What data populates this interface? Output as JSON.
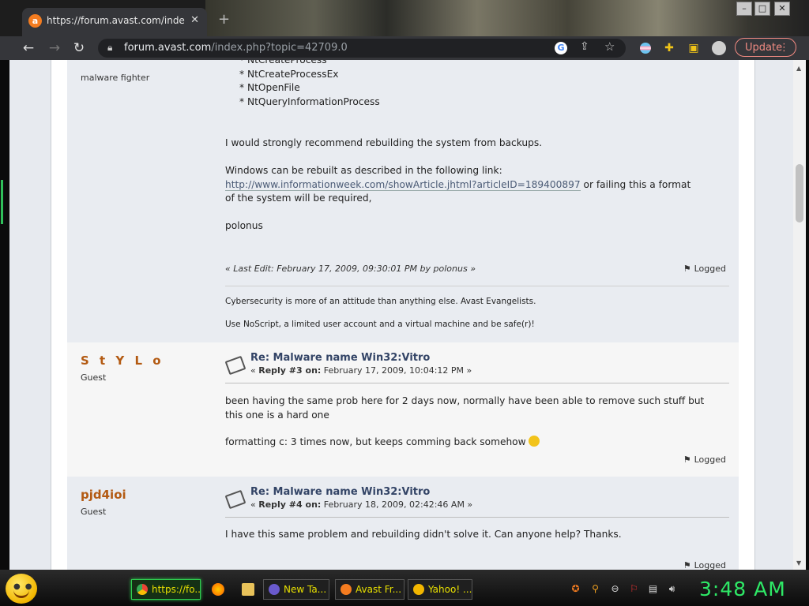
{
  "browser": {
    "tab_title": "https://forum.avast.com/index.php",
    "tab_close": "✕",
    "new_tab": "+",
    "url_host": "forum.avast.com",
    "url_path": "/index.php?topic=42709.0",
    "update_label": "Update",
    "update_menu": "⋮",
    "window_buttons": [
      "–",
      "□",
      "✕"
    ]
  },
  "posts": [
    {
      "poster_group": "malware fighter",
      "body_lines": [
        "* NtCreateProcessEx",
        "* NtOpenFile",
        "* NtQueryInformationProcess"
      ],
      "para1": "I would strongly recommend rebuilding the system from backups.",
      "para2_prefix": "Windows can be rebuilt as described in the following link:",
      "para2_link": "http://www.informationweek.com/showArticle.jhtml?articleID=189400897",
      "para2_suffix": " or failing this a format",
      "para2_end": "of the system will be required,",
      "sign": "polonus",
      "last_edit": "« Last Edit: February 17, 2009, 09:30:01 PM by polonus »",
      "logged": "Logged",
      "signature_1": "Cybersecurity is more of an attitude than anything else. Avast Evangelists.",
      "signature_2": "Use NoScript, a limited user account and a virtual machine and be safe(r)!"
    },
    {
      "poster_name": "S t Y L o",
      "poster_group": "Guest",
      "subject": "Re: Malware name Win32:Vitro",
      "reply_label": "Reply #3 on:",
      "reply_date": "February 17, 2009, 10:04:12 PM",
      "body_1": "been having the same prob here for 2 days now, normally have been able to remove such stuff but",
      "body_2": "this one is a hard one",
      "body_3": "formatting c: 3 times now, but keeps comming back somehow",
      "logged": "Logged"
    },
    {
      "poster_name": "pjd4ioi",
      "poster_group": "Guest",
      "subject": "Re: Malware name Win32:Vitro",
      "reply_label": "Reply #4 on:",
      "reply_date": "February 18, 2009, 02:42:46 AM",
      "body_1": "I have this same problem and rebuilding didn't solve it.  Can anyone help?  Thanks.",
      "logged": "Logged"
    }
  ],
  "taskbar": {
    "items": [
      {
        "label": "https://fo...",
        "color": "#4caf50"
      },
      {
        "label": "New Ta...",
        "color": "#6a5acd"
      },
      {
        "label": "Avast Fr...",
        "color": "#f47c20"
      },
      {
        "label": "Yahoo! ...",
        "color": "#f2b600"
      }
    ],
    "clock": "3:48 AM"
  },
  "colors": {
    "poster_name": "#b35a12",
    "clock": "#2ee866",
    "active_task": "#2fd050"
  }
}
